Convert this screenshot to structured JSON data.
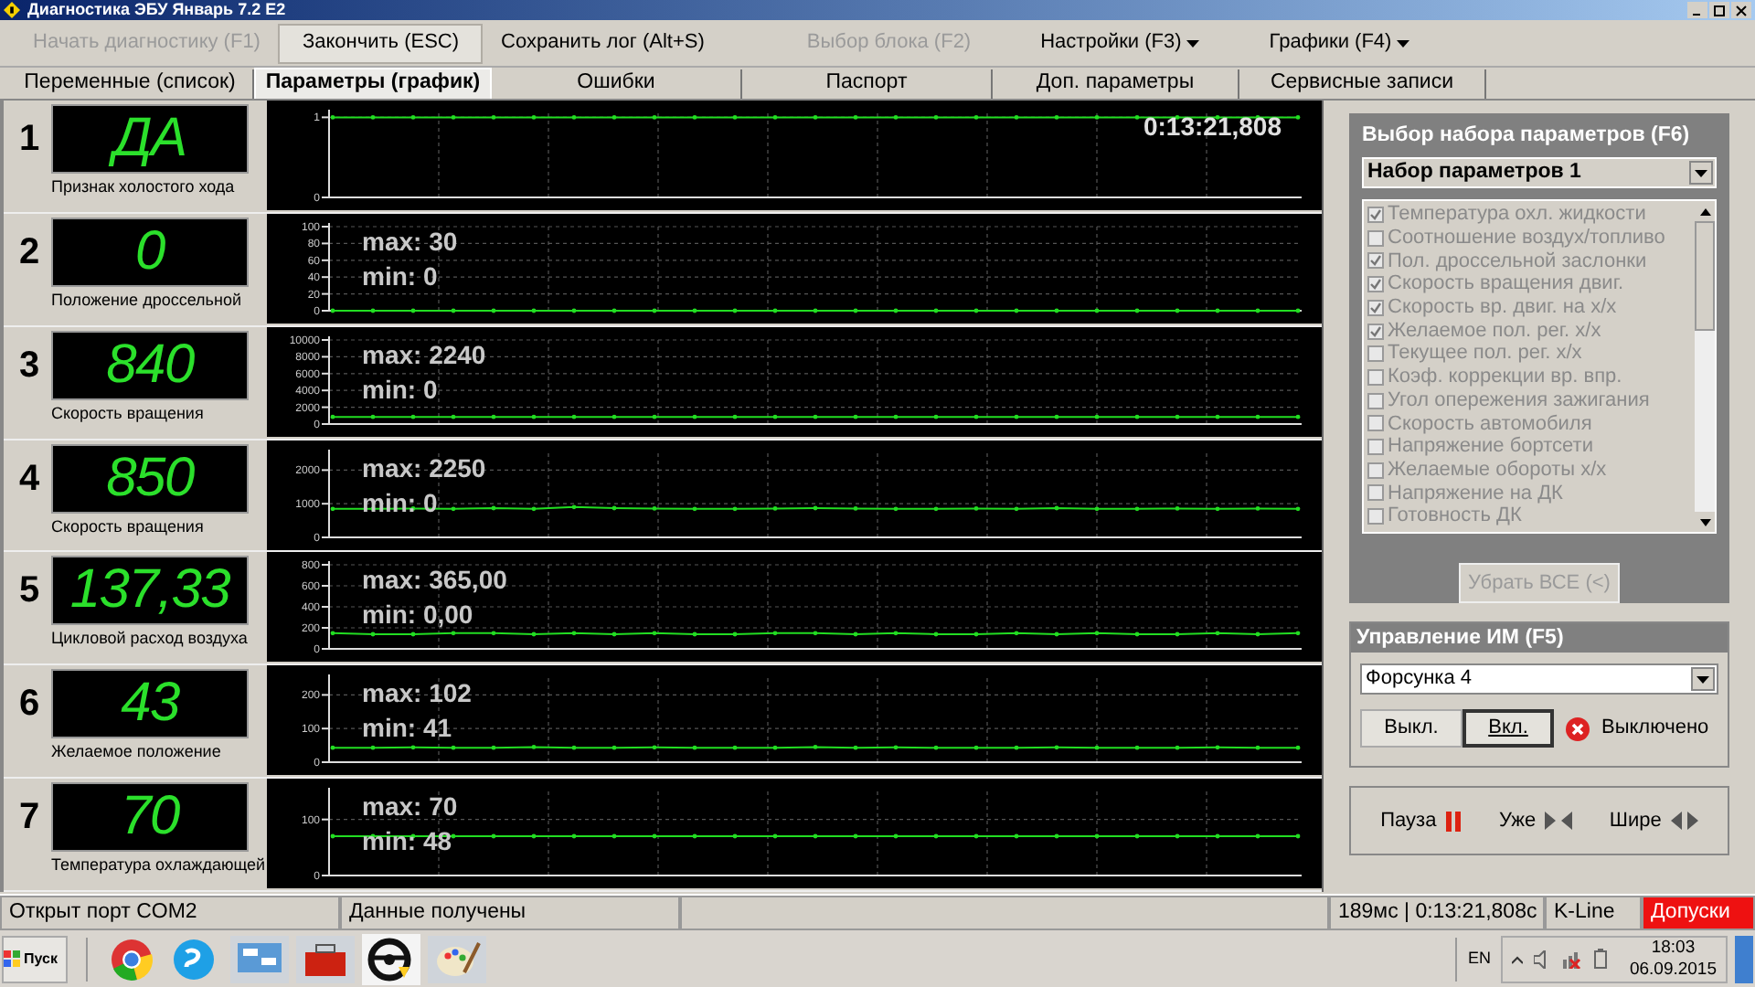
{
  "window": {
    "title": "Диагностика ЭБУ Январь 7.2 E2"
  },
  "toolbar": [
    {
      "label": "Начать диагностику (F1)",
      "disabled": true,
      "kind": "plain"
    },
    {
      "label": "Закончить (ESC)",
      "disabled": false,
      "kind": "raised"
    },
    {
      "label": "Сохранить лог (Alt+S)",
      "disabled": false,
      "kind": "plain"
    },
    {
      "label": "Выбор блока (F2)",
      "disabled": true,
      "kind": "plain"
    },
    {
      "label": "Настройки (F3)",
      "disabled": false,
      "kind": "menu"
    },
    {
      "label": "Графики (F4)",
      "disabled": false,
      "kind": "menu"
    }
  ],
  "tabs": [
    {
      "label": "Переменные (список)",
      "selected": false
    },
    {
      "label": "Параметры (график)",
      "selected": true
    },
    {
      "label": "Ошибки",
      "selected": false
    },
    {
      "label": "Паспорт",
      "selected": false
    },
    {
      "label": "Доп. параметры",
      "selected": false
    },
    {
      "label": "Сервисные записи",
      "selected": false
    }
  ],
  "rows": [
    {
      "number": "1",
      "value": "ДА",
      "label": "Признак холостого хода",
      "timestamp": "0:13:21,808",
      "chart_data": {
        "type": "line",
        "yticks": [
          0,
          1
        ],
        "ylim": [
          0,
          1.05
        ],
        "grid": true,
        "series": [
          {
            "color": "#22dd22",
            "values": [
              1,
              1,
              1,
              1,
              1,
              1,
              1,
              1,
              1,
              1,
              1,
              1,
              1,
              1,
              1,
              1,
              1,
              1,
              1,
              1,
              1,
              1,
              1,
              1,
              1
            ]
          }
        ]
      }
    },
    {
      "number": "2",
      "value": "0",
      "label": "Положение дроссельной",
      "max": "max: 30",
      "min": "min: 0",
      "chart_data": {
        "type": "line",
        "yticks": [
          0,
          20,
          40,
          60,
          80,
          100
        ],
        "ylim": [
          0,
          100
        ],
        "grid": true,
        "series": [
          {
            "color": "#22dd22",
            "values": [
              0,
              0,
              0,
              0,
              0,
              0,
              0,
              0,
              0,
              0,
              0,
              0,
              0,
              0,
              0,
              0,
              0,
              0,
              0,
              0,
              0,
              0,
              0,
              0,
              0
            ]
          }
        ]
      }
    },
    {
      "number": "3",
      "value": "840",
      "label": "Скорость вращения",
      "max": "max: 2240",
      "min": "min: 0",
      "chart_data": {
        "type": "line",
        "yticks": [
          0,
          2000,
          4000,
          6000,
          8000,
          10000
        ],
        "ylim": [
          0,
          10000
        ],
        "grid": true,
        "series": [
          {
            "color": "#22dd22",
            "values": [
              840,
              840,
              840,
              840,
              840,
              840,
              840,
              840,
              840,
              840,
              840,
              840,
              840,
              840,
              840,
              840,
              840,
              840,
              840,
              840,
              840,
              840,
              840,
              840,
              840
            ]
          }
        ]
      }
    },
    {
      "number": "4",
      "value": "850",
      "label": "Скорость вращения",
      "max": "max: 2250",
      "min": "min: 0",
      "chart_data": {
        "type": "line",
        "yticks": [
          0,
          1000,
          2000
        ],
        "ylim": [
          0,
          2500
        ],
        "grid": true,
        "series": [
          {
            "color": "#22dd22",
            "values": [
              850,
              850,
              860,
              850,
              870,
              850,
              900,
              870,
              860,
              850,
              850,
              860,
              870,
              860,
              850,
              850,
              860,
              850,
              870,
              850,
              850,
              860,
              850,
              860,
              850
            ]
          }
        ]
      }
    },
    {
      "number": "5",
      "value": "137,33",
      "label": "Цикловой расход воздуха",
      "max": "max: 365,00",
      "min": "min: 0,00",
      "chart_data": {
        "type": "line",
        "yticks": [
          0,
          200,
          400,
          600,
          800
        ],
        "ylim": [
          0,
          800
        ],
        "grid": true,
        "series": [
          {
            "color": "#22dd22",
            "values": [
              150,
              140,
              140,
              150,
              150,
              140,
              150,
              140,
              150,
              140,
              140,
              150,
              150,
              140,
              150,
              140,
              140,
              150,
              140,
              150,
              140,
              140,
              150,
              140,
              150
            ]
          }
        ]
      }
    },
    {
      "number": "6",
      "value": "43",
      "label": "Желаемое положение",
      "max": "max: 102",
      "min": "min: 41",
      "chart_data": {
        "type": "line",
        "yticks": [
          0,
          100,
          200
        ],
        "ylim": [
          0,
          250
        ],
        "grid": true,
        "series": [
          {
            "color": "#22dd22",
            "values": [
              43,
              43,
              44,
              43,
              43,
              45,
              43,
              43,
              44,
              43,
              43,
              43,
              45,
              43,
              44,
              43,
              43,
              43,
              44,
              43,
              43,
              43,
              44,
              43,
              43
            ]
          }
        ]
      }
    },
    {
      "number": "7",
      "value": "70",
      "label": "Температура охлаждающей",
      "max": "max: 70",
      "min": "min: 48",
      "chart_data": {
        "type": "line",
        "yticks": [
          0,
          100
        ],
        "ylim": [
          0,
          150
        ],
        "grid": true,
        "series": [
          {
            "color": "#22dd22",
            "values": [
              70,
              70,
              70,
              70,
              70,
              70,
              70,
              70,
              70,
              70,
              70,
              70,
              70,
              70,
              70,
              70,
              70,
              70,
              70,
              70,
              70,
              70,
              70,
              70,
              70
            ]
          }
        ]
      }
    }
  ],
  "param_set": {
    "title": "Выбор набора параметров (F6)",
    "value": "Набор параметров 1",
    "disabled": true,
    "items": [
      {
        "label": "Температура охл. жидкости",
        "checked": true
      },
      {
        "label": "Соотношение воздух/топливо",
        "checked": false
      },
      {
        "label": "Пол. дроссельной заслонки",
        "checked": true
      },
      {
        "label": "Скорость вращения двиг.",
        "checked": true
      },
      {
        "label": "Скорость вр. двиг. на х/х",
        "checked": true
      },
      {
        "label": "Желаемое пол. рег. х/х",
        "checked": true
      },
      {
        "label": "Текущее пол. рег. х/х",
        "checked": false
      },
      {
        "label": "Коэф. коррекции вр. впр.",
        "checked": false
      },
      {
        "label": "Угол опережения зажигания",
        "checked": false
      },
      {
        "label": "Скорость автомобиля",
        "checked": false
      },
      {
        "label": "Напряжение бортсети",
        "checked": false
      },
      {
        "label": "Желаемые обороты х/х",
        "checked": false
      },
      {
        "label": "Напряжение на ДК",
        "checked": false
      },
      {
        "label": "Готовность ДК",
        "checked": false
      }
    ],
    "button": "Убрать ВСЕ (<)"
  },
  "actuator": {
    "title": "Управление ИМ (F5)",
    "value": "Форсунка 4",
    "off_button": "Выкл.",
    "on_button": "Вкл.",
    "status": "Выключено",
    "on": false
  },
  "playback": [
    {
      "label": "Пауза",
      "kind": "pause"
    },
    {
      "label": "Уже",
      "kind": "narrow"
    },
    {
      "label": "Шире",
      "kind": "wide"
    }
  ],
  "status_bar": [
    {
      "text": "Открыт порт COM2",
      "kind": "plain"
    },
    {
      "text": "Данные получены",
      "kind": "plain"
    },
    {
      "text": "189мс | 0:13:21,808с",
      "kind": "plain"
    },
    {
      "text": "K-Line",
      "kind": "plain"
    },
    {
      "text": "Допуски",
      "kind": "alert"
    }
  ],
  "taskbar": {
    "start": "Пуск",
    "language": "EN",
    "time": "18:03",
    "date": "06.09.2015"
  }
}
